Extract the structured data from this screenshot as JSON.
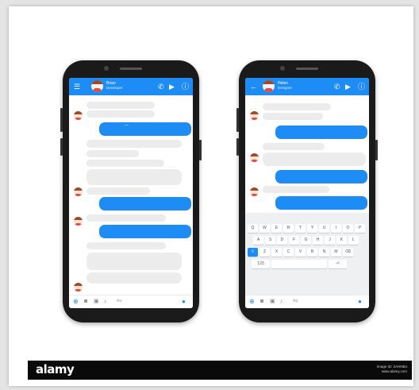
{
  "colors": {
    "accent": "#1e8cf5",
    "bubble_gray": "#ececec",
    "phone_body": "#1a1a1a",
    "footer_bg": "#0a0a0a"
  },
  "phone_left": {
    "header": {
      "contact_name": "Brian",
      "contact_status": "Developer",
      "icons": [
        "menu-icon",
        "phone-icon",
        "video-icon",
        "info-icon"
      ]
    },
    "chat_icons": [
      "camera-icon",
      "image-icon",
      "mic-icon",
      "emoji-icon",
      "like-icon"
    ],
    "input_placeholder": "Aa"
  },
  "phone_right": {
    "header": {
      "contact_name": "Helen",
      "contact_status": "Designer",
      "icons": [
        "back-icon",
        "phone-icon",
        "video-icon",
        "info-icon"
      ]
    },
    "chat_icons": [
      "camera-icon",
      "image-icon",
      "mic-icon",
      "emoji-icon",
      "like-icon"
    ],
    "input_placeholder": "Aa",
    "keyboard": {
      "row1": [
        "Q",
        "W",
        "E",
        "R",
        "T",
        "Y",
        "U",
        "I",
        "O",
        "P"
      ],
      "row2": [
        "A",
        "S",
        "D",
        "F",
        "G",
        "H",
        "J",
        "K",
        "L"
      ],
      "row3": [
        "⇧",
        "Z",
        "X",
        "C",
        "V",
        "B",
        "N",
        "M",
        "⌫"
      ],
      "row4": [
        "123",
        "",
        "⏎"
      ]
    }
  },
  "watermark": {
    "logo": "alamy",
    "image_id": "Image ID: 2AHNB4",
    "site": "www.alamy.com"
  }
}
